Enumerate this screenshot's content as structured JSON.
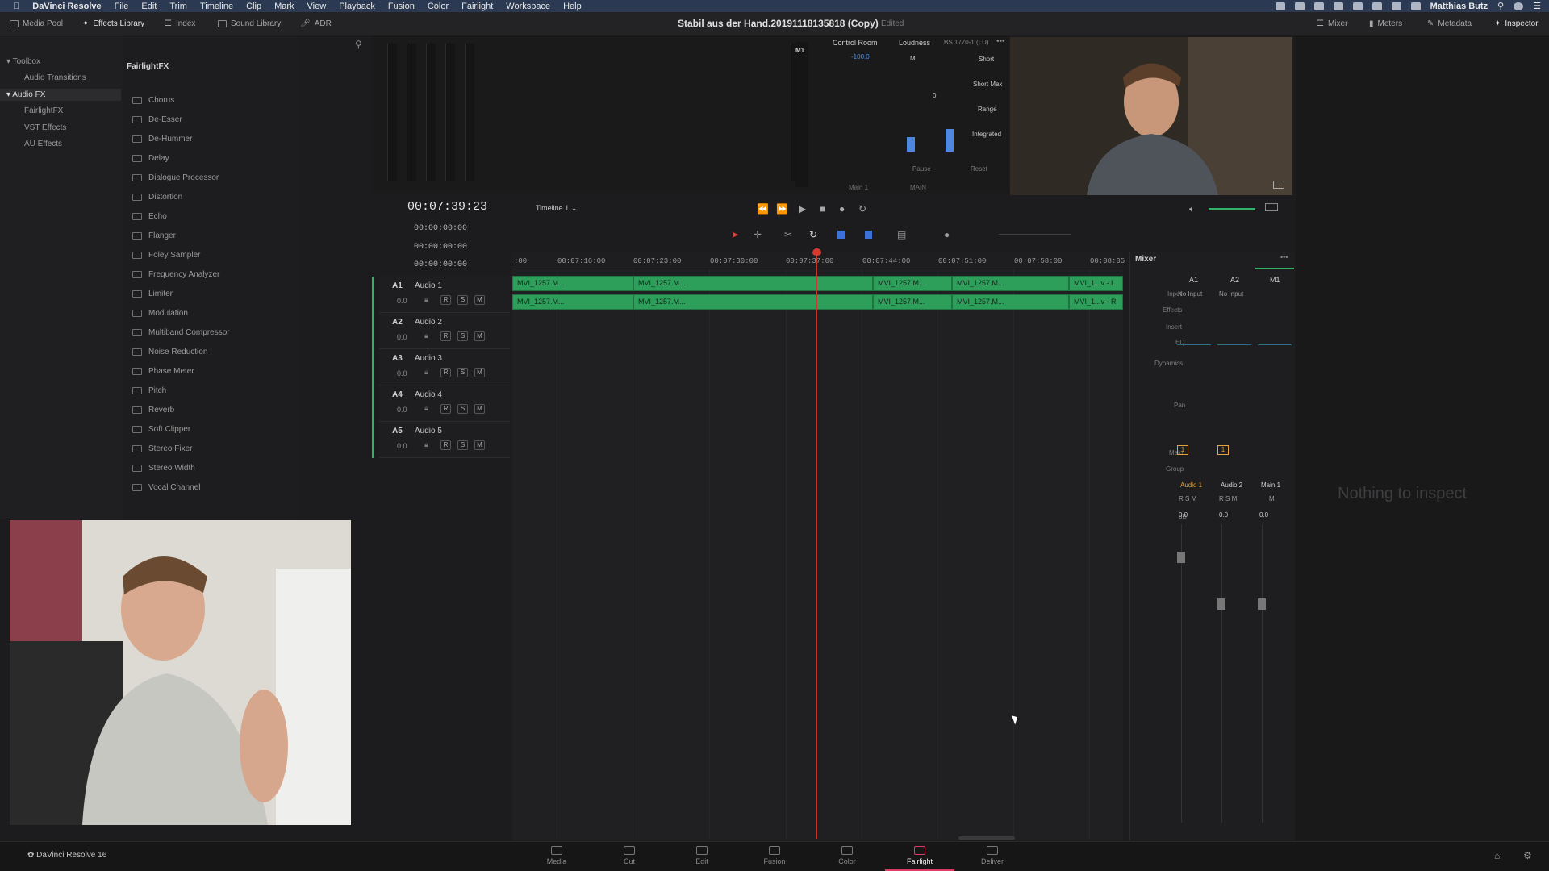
{
  "menubar": {
    "app_name": "DaVinci Resolve",
    "items": [
      "File",
      "Edit",
      "Trim",
      "Timeline",
      "Clip",
      "Mark",
      "View",
      "Playback",
      "Fusion",
      "Color",
      "Fairlight",
      "Workspace",
      "Help"
    ],
    "user": "Matthias Butz"
  },
  "toolbar": {
    "media_pool": "Media Pool",
    "effects_library": "Effects Library",
    "index": "Index",
    "sound_library": "Sound Library",
    "adr": "ADR",
    "project_title": "Stabil aus der Hand.20191118135818 (Copy)",
    "project_status": "Edited",
    "mixer": "Mixer",
    "meters": "Meters",
    "metadata": "Metadata",
    "inspector": "Inspector"
  },
  "toolbox": {
    "title": "Toolbox",
    "audio_transitions": "Audio Transitions",
    "audio_fx": "Audio FX",
    "sub": [
      "FairlightFX",
      "VST Effects",
      "AU Effects"
    ]
  },
  "fx_panel": {
    "title": "FairlightFX",
    "items": [
      "Chorus",
      "De-Esser",
      "De-Hummer",
      "Delay",
      "Dialogue Processor",
      "Distortion",
      "Echo",
      "Flanger",
      "Foley Sampler",
      "Frequency Analyzer",
      "Limiter",
      "Modulation",
      "Multiband Compressor",
      "Noise Reduction",
      "Phase Meter",
      "Pitch",
      "Reverb",
      "Soft Clipper",
      "Stereo Fixer",
      "Stereo Width",
      "Vocal Channel"
    ]
  },
  "control_room": {
    "m1": "M1",
    "title": "Control Room",
    "value": "-100.0",
    "main": "Main 1",
    "main_out": "MAIN"
  },
  "loudness": {
    "title": "Loudness",
    "standard": "BS.1770-1 (LU)",
    "m": "M",
    "zero": "0",
    "labels": [
      "Short",
      "Short Max",
      "Range",
      "Integrated"
    ],
    "pause": "Pause",
    "reset": "Reset"
  },
  "transport": {
    "timecode": "00:07:39:23",
    "timeline_name": "Timeline 1",
    "tc_lines": [
      "00:00:00:00",
      "00:00:00:00",
      "00:00:00:00"
    ]
  },
  "tracks": [
    {
      "id": "A1",
      "name": "Audio 1",
      "value": "0.0"
    },
    {
      "id": "A2",
      "name": "Audio 2",
      "value": "0.0"
    },
    {
      "id": "A3",
      "name": "Audio 3",
      "value": "0.0"
    },
    {
      "id": "A4",
      "name": "Audio 4",
      "value": "0.0"
    },
    {
      "id": "A5",
      "name": "Audio 5",
      "value": "0.0"
    }
  ],
  "rsm": [
    "R",
    "S",
    "M"
  ],
  "ruler": [
    ":00",
    "00:07:16:00",
    "00:07:23:00",
    "00:07:30:00",
    "00:07:37:00",
    "00:07:44:00",
    "00:07:51:00",
    "00:07:58:00",
    "00:08:05"
  ],
  "clips": {
    "row1": [
      "MVI_1257.M...",
      "MVI_1257.M...",
      "",
      "MVI_1257.M...",
      "MVI_1257.M...",
      "MVI_1...v - L"
    ],
    "row2": [
      "MVI_1257.M...",
      "MVI_1257.M...",
      "",
      "MVI_1257.M...",
      "MVI_1257.M...",
      "MVI_1...v - R"
    ]
  },
  "mixer": {
    "title": "Mixer",
    "columns": [
      "A1",
      "A2",
      "M1"
    ],
    "row_labels": [
      "Input",
      "Effects",
      "Insert",
      "EQ",
      "Dynamics",
      "Pan",
      "Main",
      "Group",
      "dB"
    ],
    "inputs": [
      "No Input",
      "No Input"
    ],
    "main_badges": [
      "1",
      "1"
    ],
    "channel_names": [
      "Audio 1",
      "Audio 2",
      "Main 1"
    ],
    "db_values": [
      "0.0",
      "0.0",
      "0.0"
    ],
    "rsm_labels": [
      "R",
      "S",
      "M"
    ]
  },
  "inspector": {
    "empty_text": "Nothing to inspect"
  },
  "bottom": {
    "brand": "DaVinci Resolve 16",
    "pages": [
      "Media",
      "Cut",
      "Edit",
      "Fusion",
      "Color",
      "Fairlight",
      "Deliver"
    ],
    "active_page": "Fairlight"
  },
  "colors": {
    "clip_green": "#2e9e5b",
    "playhead_red": "#c0392b",
    "accent_pink": "#e03a67",
    "audio1_orange": "#e6a23c"
  }
}
